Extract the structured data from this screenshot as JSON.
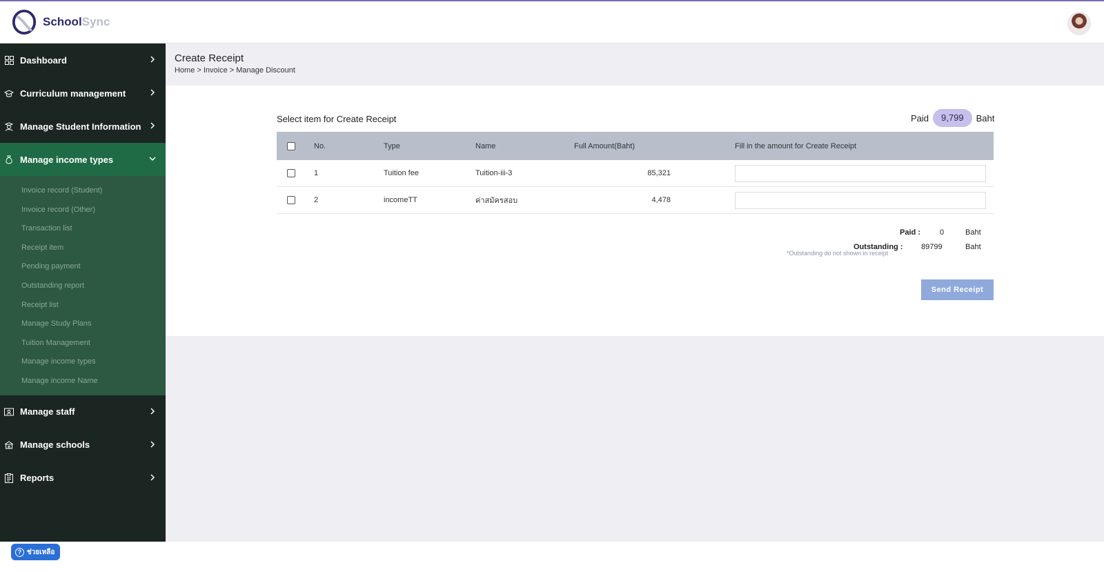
{
  "app": {
    "logo_text_a": "School",
    "logo_text_b": "Sync"
  },
  "sidebar": {
    "items": [
      {
        "label": "Dashboard",
        "icon": "grid-icon"
      },
      {
        "label": "Curriculum management",
        "icon": "graduation-cap-icon"
      },
      {
        "label": "Manage Student Information",
        "icon": "student-icon"
      },
      {
        "label": "Manage income types",
        "icon": "money-bag-icon",
        "active": true
      },
      {
        "label": "Manage staff",
        "icon": "id-card-icon"
      },
      {
        "label": "Manage schools",
        "icon": "school-icon"
      },
      {
        "label": "Reports",
        "icon": "clipboard-icon"
      }
    ],
    "subitems": [
      "Invoice record (Student)",
      "Invoice record (Other)",
      "Transaction list",
      "Receipt item",
      "Pending payment",
      "Outstanding report",
      "Receipt list",
      "Manage Study Plans",
      "Tuition Management",
      "Manage income types",
      "Manage income Name"
    ]
  },
  "header": {
    "title": "Create Receipt",
    "breadcrumb": "Home > Invoice > Manage Discount"
  },
  "receipt": {
    "select_title": "Select item for Create Receipt",
    "paid_label": "Paid",
    "paid_value": "9,799",
    "paid_unit": "Baht",
    "columns": [
      "No.",
      "Type",
      "Name",
      "Full Amount(Baht)",
      "Fill in the amount for Create Receipt"
    ],
    "rows": [
      {
        "no": "1",
        "type": "Tuition fee",
        "name": "Tuition-iii-3",
        "amount": "85,321",
        "fill": ""
      },
      {
        "no": "2",
        "type": "incomeTT",
        "name": "ค่าสมัครสอบ",
        "amount": "4,478",
        "fill": ""
      }
    ],
    "totals": {
      "paid_label": "Paid :",
      "paid_value": "0",
      "paid_unit": "Baht",
      "outstanding_label": "Outstanding :",
      "outstanding_value": "89799",
      "outstanding_unit": "Baht",
      "note": "*Outstanding do not shown in receipt"
    },
    "send_label": "Send Receipt"
  },
  "help": {
    "label": "ช่วยเหลือ"
  },
  "colors": {
    "sidebar_bg": "#1b2623",
    "sidebar_active": "#1f6b46",
    "submenu_bg": "#2d5842",
    "table_header": "#b8bfcb",
    "paid_pill": "#c7bfec",
    "send_button": "#8fa9db",
    "help_button": "#2a6fd6"
  }
}
